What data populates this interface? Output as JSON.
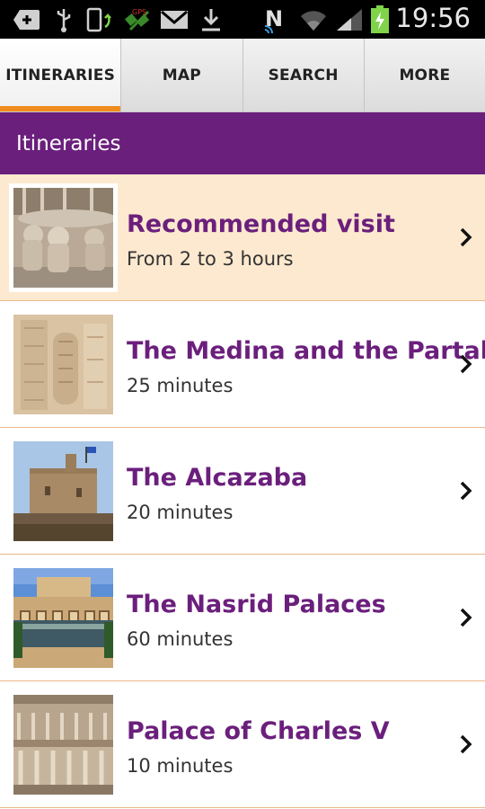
{
  "status_bar": {
    "time": "19:56",
    "icons": [
      "add-icon",
      "usb-icon",
      "phone-update-icon",
      "satellite-icon",
      "mail-icon",
      "download-icon",
      "nfc-icon",
      "wifi-icon",
      "signal-icon",
      "battery-charging-icon"
    ]
  },
  "tabs": [
    {
      "label": "ITINERARIES",
      "active": true
    },
    {
      "label": "MAP",
      "active": false
    },
    {
      "label": "SEARCH",
      "active": false
    },
    {
      "label": "MORE",
      "active": false
    }
  ],
  "section": {
    "title": "Itineraries"
  },
  "itineraries": [
    {
      "title": "Recommended visit",
      "subtitle": "From 2 to 3 hours",
      "thumbnail": "lions-fountain",
      "highlighted": true
    },
    {
      "title": "The Medina and the Partal",
      "subtitle": "25 minutes",
      "thumbnail": "carved-wall",
      "highlighted": false
    },
    {
      "title": "The Alcazaba",
      "subtitle": "20 minutes",
      "thumbnail": "tower",
      "highlighted": false
    },
    {
      "title": "The Nasrid Palaces",
      "subtitle": "60 minutes",
      "thumbnail": "courtyard-pool",
      "highlighted": false
    },
    {
      "title": "Palace of Charles V",
      "subtitle": "10 minutes",
      "thumbnail": "colonnade",
      "highlighted": false
    }
  ],
  "colors": {
    "accent_purple": "#6b1f7c",
    "tab_indicator": "#f08c1e",
    "highlight_row": "#fde9cf"
  }
}
